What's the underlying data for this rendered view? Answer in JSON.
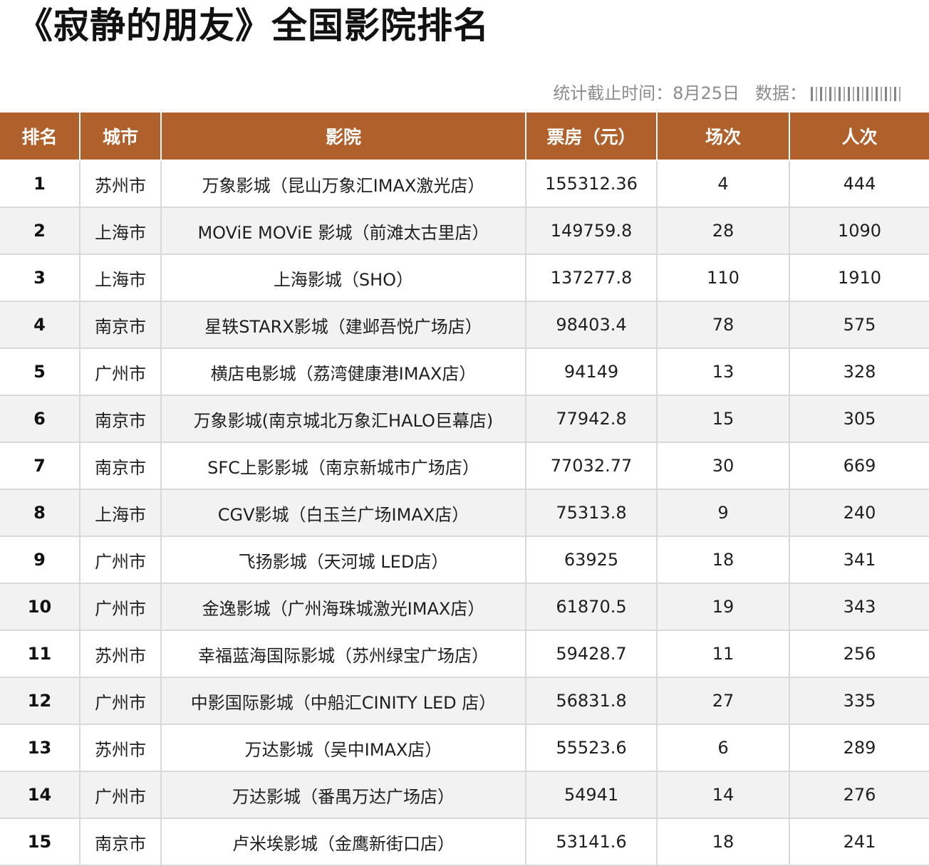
{
  "title": "《寂静的朋友》全国影院排名",
  "meta": {
    "cutoff": "统计截止时间：8月25日",
    "source_label": "数据："
  },
  "table": {
    "headers": [
      "排名",
      "城市",
      "影院",
      "票房（元）",
      "场次",
      "人次"
    ],
    "rows": [
      [
        "1",
        "苏州市",
        "万象影城（昆山万象汇IMAX激光店）",
        "155312.36",
        "4",
        "444"
      ],
      [
        "2",
        "上海市",
        "MOViE MOViE 影城（前滩太古里店）",
        "149759.8",
        "28",
        "1090"
      ],
      [
        "3",
        "上海市",
        "上海影城（SHO）",
        "137277.8",
        "110",
        "1910"
      ],
      [
        "4",
        "南京市",
        "星轶STARX影城（建邺吾悦广场店）",
        "98403.4",
        "78",
        "575"
      ],
      [
        "5",
        "广州市",
        "横店电影城（荔湾健康港IMAX店）",
        "94149",
        "13",
        "328"
      ],
      [
        "6",
        "南京市",
        "万象影城(南京城北万象汇HALO巨幕店)",
        "77942.8",
        "15",
        "305"
      ],
      [
        "7",
        "南京市",
        "SFC上影影城（南京新城市广场店）",
        "77032.77",
        "30",
        "669"
      ],
      [
        "8",
        "上海市",
        "CGV影城（白玉兰广场IMAX店）",
        "75313.8",
        "9",
        "240"
      ],
      [
        "9",
        "广州市",
        "飞扬影城（天河城 LED店）",
        "63925",
        "18",
        "341"
      ],
      [
        "10",
        "广州市",
        "金逸影城（广州海珠城激光IMAX店）",
        "61870.5",
        "19",
        "343"
      ],
      [
        "11",
        "苏州市",
        "幸福蓝海国际影城（苏州绿宝广场店）",
        "59428.7",
        "11",
        "256"
      ],
      [
        "12",
        "广州市",
        "中影国际影城（中船汇CINITY LED 店）",
        "56831.8",
        "27",
        "335"
      ],
      [
        "13",
        "苏州市",
        "万达影城（吴中IMAX店）",
        "55523.6",
        "6",
        "289"
      ],
      [
        "14",
        "广州市",
        "万达影城（番禺万达广场店）",
        "54941",
        "14",
        "276"
      ],
      [
        "15",
        "南京市",
        "卢米埃影城（金鹰新街口店）",
        "53141.6",
        "18",
        "241"
      ]
    ]
  },
  "colors": {
    "header_bg": "#b0602a",
    "alt_row_bg": "#f2f2f2"
  }
}
